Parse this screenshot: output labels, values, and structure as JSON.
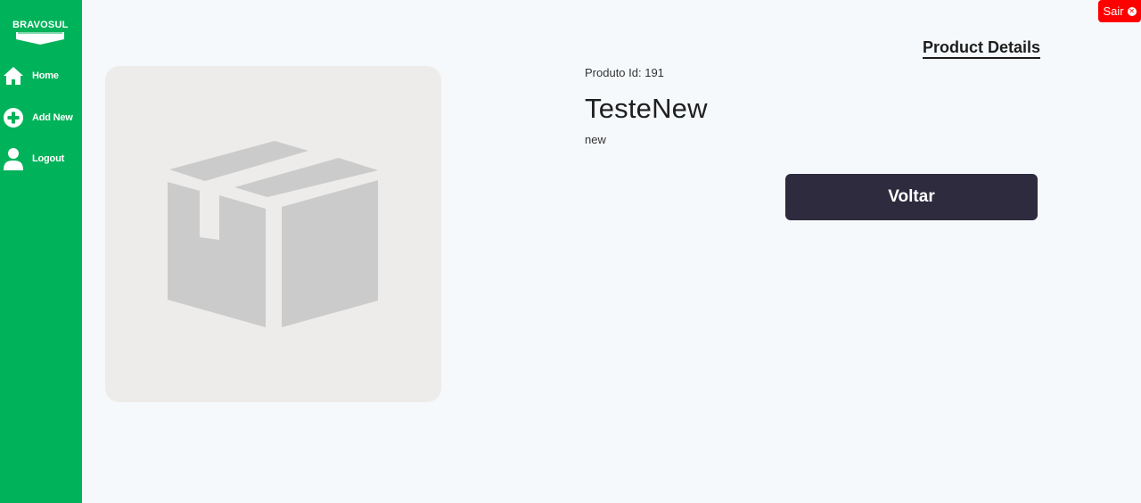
{
  "app": {
    "brand": "BRAVOSUL",
    "accent_color": "#00b259",
    "exit_color": "#ff0000"
  },
  "sidebar": {
    "items": [
      {
        "label": "Home",
        "icon": "home-icon"
      },
      {
        "label": "Add New",
        "icon": "plus-circle-icon"
      },
      {
        "label": "Logout",
        "icon": "user-icon"
      }
    ]
  },
  "header": {
    "exit_label": "Sair",
    "title": "Product Details"
  },
  "product": {
    "id_label": "Produto Id: 191",
    "name": "TesteNew",
    "description": "new",
    "image_icon": "package-box-icon"
  },
  "actions": {
    "back_label": "Voltar"
  }
}
